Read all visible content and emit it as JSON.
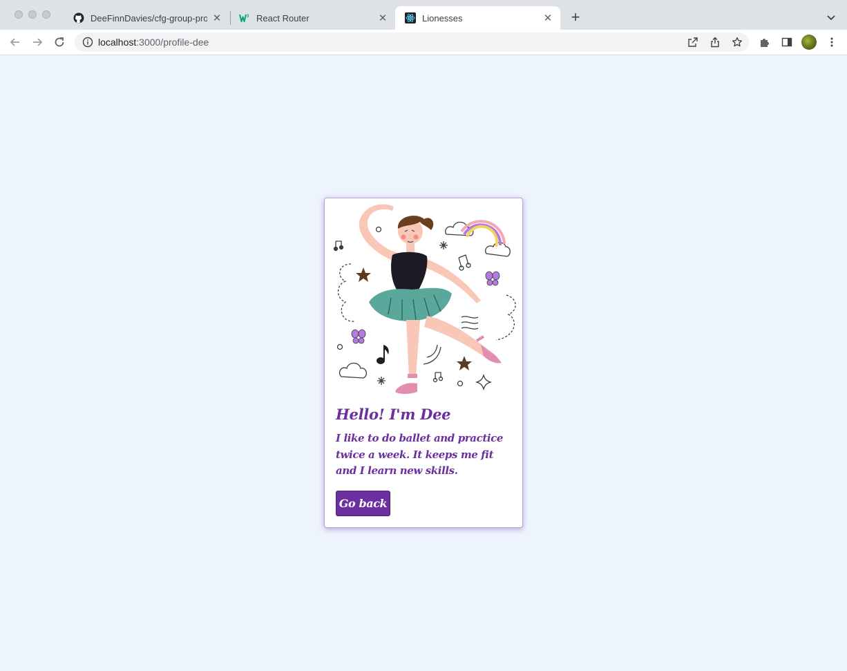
{
  "browser": {
    "tabs": [
      {
        "title": "DeeFinnDavies/cfg-group-proje",
        "icon": "github-icon",
        "active": false
      },
      {
        "title": "React Router",
        "icon": "w3schools-icon",
        "active": false
      },
      {
        "title": "Lionesses",
        "icon": "react-icon",
        "active": true
      }
    ],
    "new_tab_label": "+",
    "close_glyph": "✕",
    "url_host": "localhost",
    "url_path": ":3000/profile-dee"
  },
  "profile": {
    "illustration": "ballerina-illustration",
    "heading": "Hello! I'm Dee",
    "bio": "I like to do ballet and practice twice a week. It keeps me fit and I learn new skills.",
    "back_button_label": "Go back"
  },
  "colors": {
    "page_background": "#eef4fd",
    "accent_purple": "#6b2fa0",
    "card_background": "#ffffff"
  }
}
